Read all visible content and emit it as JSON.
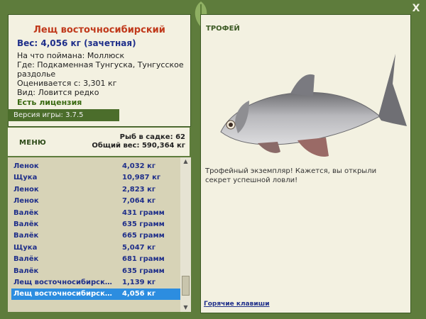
{
  "window": {
    "close_label": "X"
  },
  "fish_card": {
    "title": "Лещ восточносибирский",
    "weight": "Вес: 4,056 кг (зачетная)",
    "bait": "На что поймана: Моллюск",
    "location": "Где: Подкаменная Тунгуска, Тунгусское раздолье",
    "estimate": "Оценивается с: 3,301 кг",
    "kind": "Вид: Ловится редко",
    "license": "Есть лицензия",
    "version": "Версия игры: 3.7.5"
  },
  "menu": {
    "label": "МЕНЮ",
    "caught_count": "Рыб в садке: 62",
    "total_weight": "Общий вес: 590,364 кг"
  },
  "catch_list": [
    {
      "name": "Ленок",
      "weight": "4,032 кг"
    },
    {
      "name": "Щука",
      "weight": "10,987 кг"
    },
    {
      "name": "Ленок",
      "weight": "2,823 кг"
    },
    {
      "name": "Ленок",
      "weight": "7,064 кг"
    },
    {
      "name": "Валёк",
      "weight": "431 грамм"
    },
    {
      "name": "Валёк",
      "weight": "635 грамм"
    },
    {
      "name": "Валёк",
      "weight": "665 грамм"
    },
    {
      "name": "Щука",
      "weight": "5,047 кг"
    },
    {
      "name": "Валёк",
      "weight": "681 грамм"
    },
    {
      "name": "Валёк",
      "weight": "635 грамм"
    },
    {
      "name": "Лещ восточносибирский",
      "weight": "1,139 кг"
    },
    {
      "name": "Лещ восточносибирский",
      "weight": "4,056 кг"
    }
  ],
  "trophy": {
    "title": "ТРОФЕЙ",
    "text": "Трофейный экземпляр! Кажется, вы открыли секрет успешной ловли!",
    "hotkeys": "Горячие клавиши"
  },
  "colors": {
    "frame": "#5e7c3c",
    "panel": "#f3f1e1",
    "list_bg": "#d7d3b7",
    "selected_row": "#2c8de0",
    "title_red": "#c0391b",
    "text_blue": "#1f2f8a"
  },
  "icons": {
    "logo": "leaf-icon",
    "scroll_up": "arrow-up-icon",
    "scroll_down": "arrow-down-icon"
  }
}
